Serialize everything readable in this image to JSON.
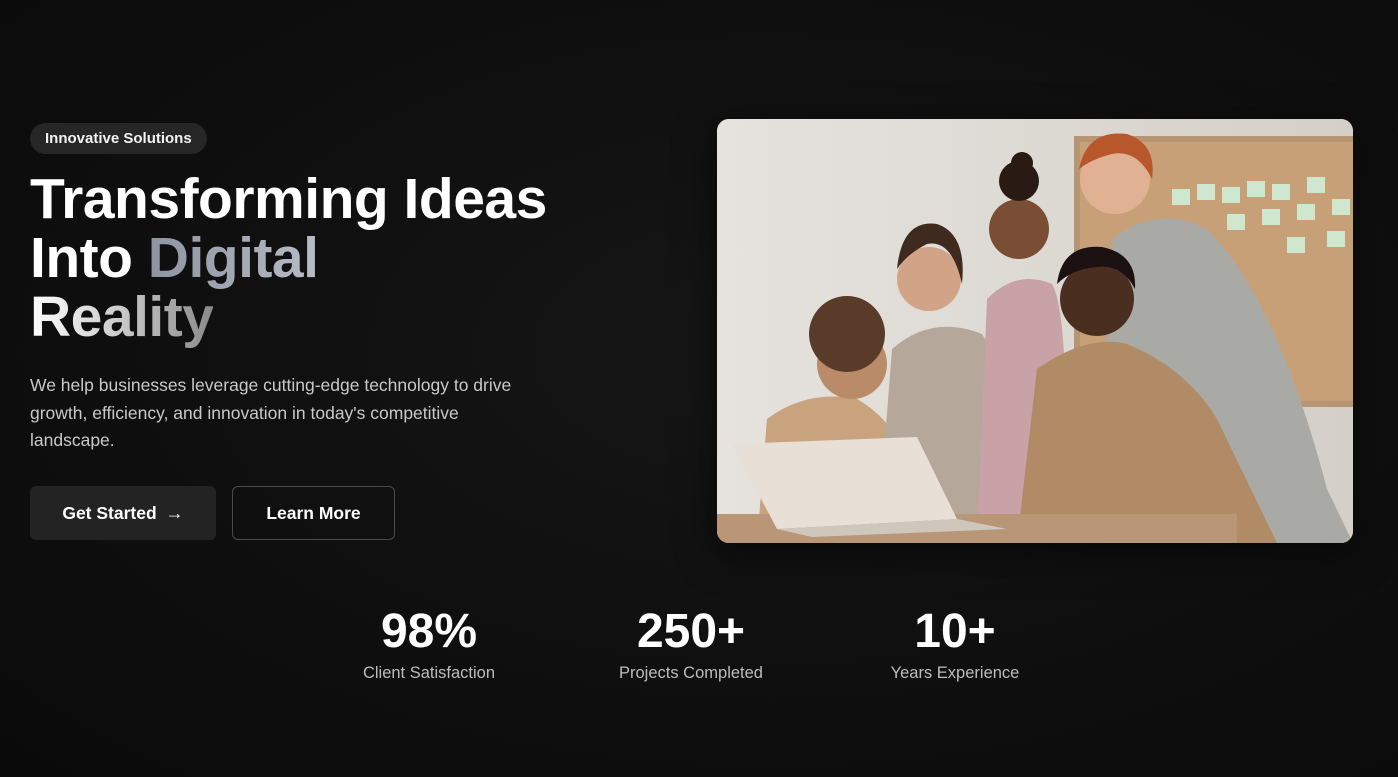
{
  "hero": {
    "badge": "Innovative Solutions",
    "headline": {
      "line1": "Transforming Ideas",
      "line2_plain": "Into ",
      "line2_accent": "Digital",
      "line3": "Reality"
    },
    "subtext": "We help businesses leverage cutting-edge technology to drive growth, efficiency, and innovation in today's competitive landscape.",
    "primary_button": "Get Started",
    "primary_button_icon": "arrow-right-icon",
    "secondary_button": "Learn More",
    "image_description_icon": "team-photo"
  },
  "stats": [
    {
      "value": "98%",
      "label": "Client Satisfaction"
    },
    {
      "value": "250+",
      "label": "Projects Completed"
    },
    {
      "value": "10+",
      "label": "Years Experience"
    }
  ],
  "colors": {
    "background": "#0f0f0f",
    "button_primary": "#232323",
    "badge": "#262626",
    "accent_text": "#a4aab5"
  }
}
